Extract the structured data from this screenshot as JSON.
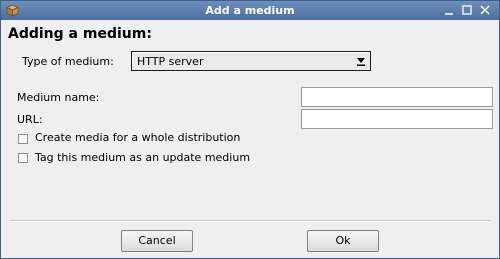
{
  "window": {
    "title": "Add a medium"
  },
  "heading": "Adding a medium:",
  "type_label": "Type of medium:",
  "type_select": {
    "value": "HTTP server"
  },
  "name_label": "Medium name:",
  "name_input": {
    "value": ""
  },
  "url_label": "URL:",
  "url_input": {
    "value": ""
  },
  "checkboxes": [
    {
      "label": "Create media for a whole distribution",
      "checked": false
    },
    {
      "label": "Tag this medium as an update medium",
      "checked": false
    }
  ],
  "buttons": {
    "cancel": "Cancel",
    "ok": "Ok"
  },
  "icons": {
    "app": "package-icon",
    "minimize": "minimize-icon",
    "maximize": "maximize-icon",
    "close": "close-icon",
    "dropdown": "dropdown-arrow-icon"
  },
  "colors": {
    "titlebar": "#4a6e9e",
    "title_text": "#ffffff"
  }
}
